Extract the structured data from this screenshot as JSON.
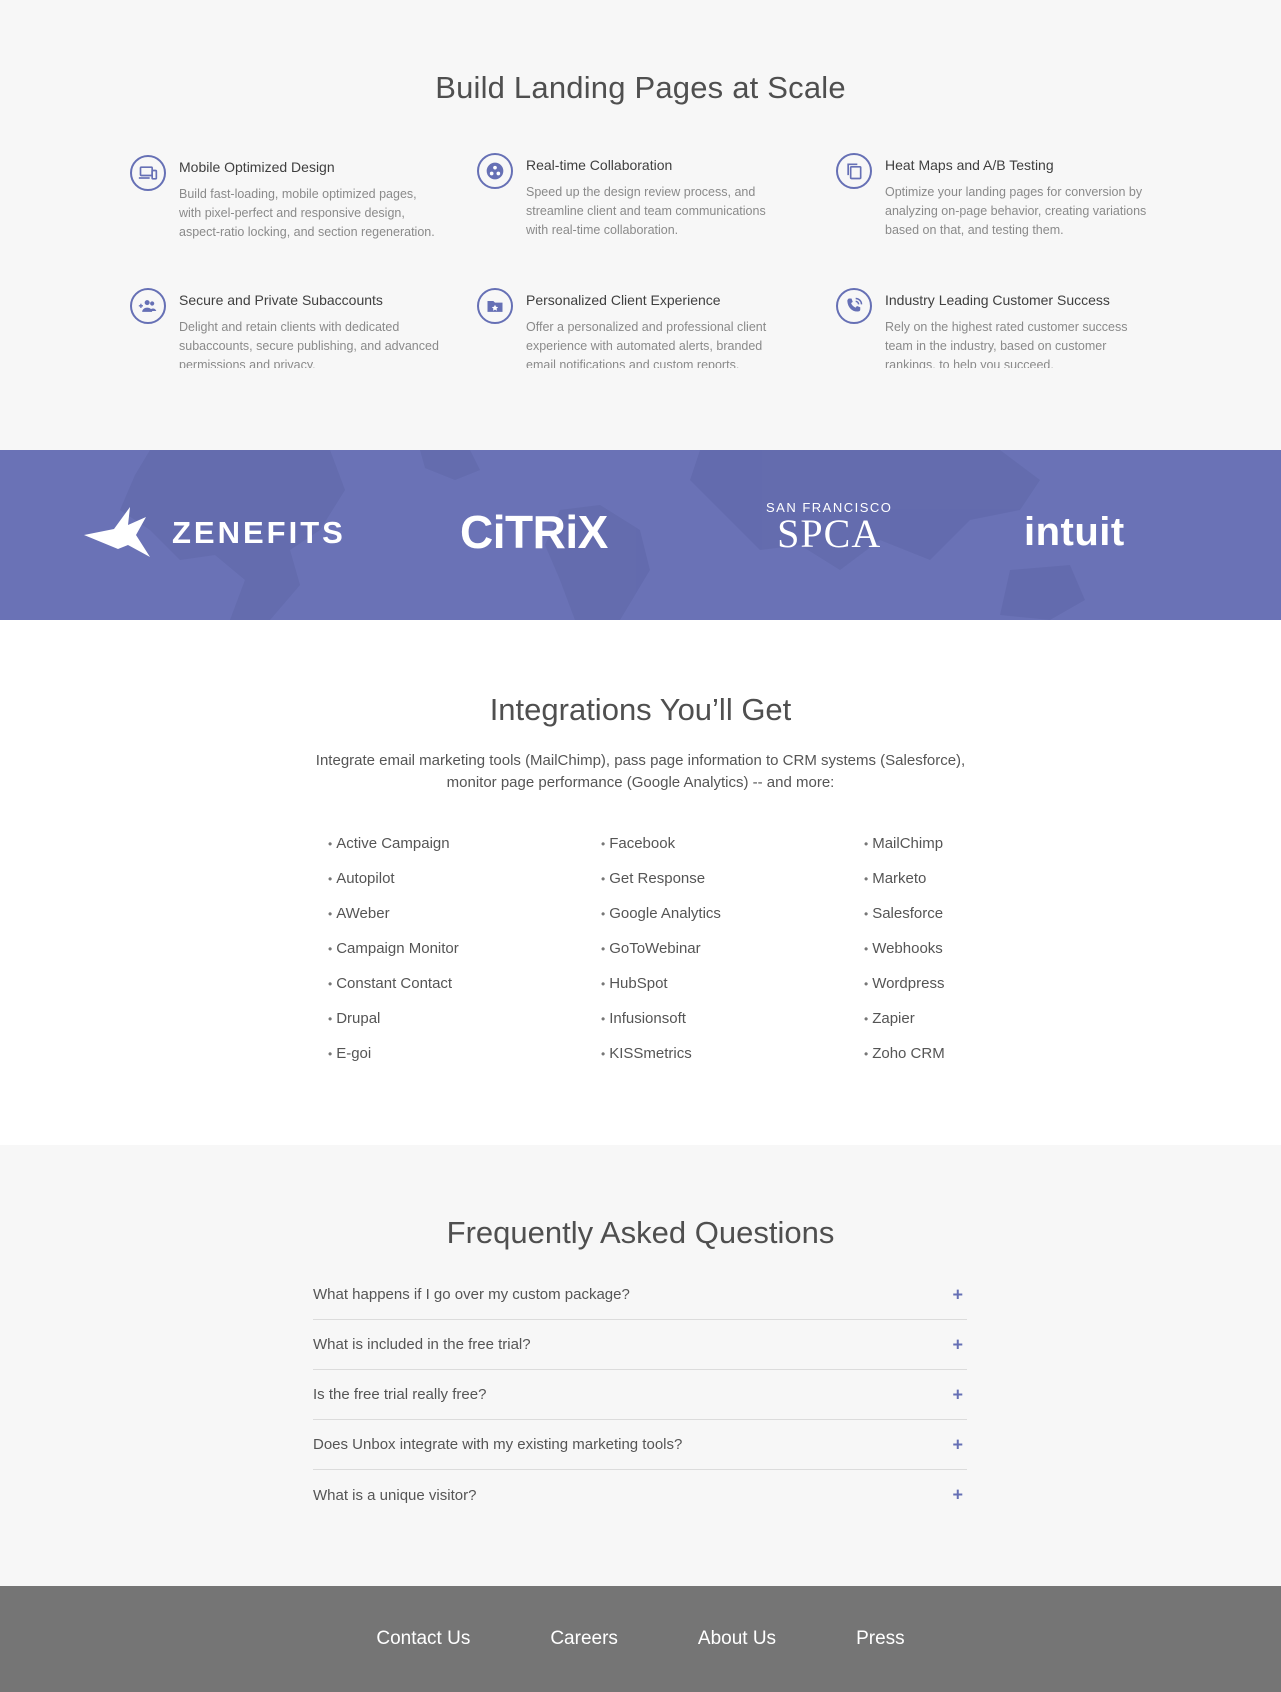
{
  "features": {
    "title": "Build Landing Pages at Scale",
    "items": [
      {
        "icon": "devices-icon",
        "title": "Mobile Optimized Design",
        "description": "Build fast-loading, mobile optimized pages, with pixel-perfect and responsive design, aspect-ratio locking, and section regeneration."
      },
      {
        "icon": "collaboration-icon",
        "title": "Real-time Collaboration",
        "description": "Speed up the design review process, and streamline client and team communications with real-time collaboration."
      },
      {
        "icon": "copy-icon",
        "title": "Heat Maps and A/B Testing",
        "description": "Optimize your landing pages for conversion by analyzing on-page behavior, creating variations based on that, and testing them."
      },
      {
        "icon": "group-add-icon",
        "title": "Secure and Private Subaccounts",
        "description": "Delight and retain clients with dedicated subaccounts, secure publishing, and advanced permissions and privacy."
      },
      {
        "icon": "folder-star-icon",
        "title": "Personalized Client Experience",
        "description": "Offer a personalized and professional client experience with automated alerts, branded email notifications and custom reports."
      },
      {
        "icon": "phone-icon",
        "title": "Industry Leading Customer Success",
        "description": "Rely on the highest rated customer success team in the industry, based on customer rankings, to help you succeed."
      }
    ]
  },
  "logos": {
    "zenefits": "ZENEFITS",
    "citrix": "CiTRiX",
    "spca_top": "SAN FRANCISCO",
    "spca_main": "SPCA",
    "intuit": "intuit"
  },
  "integrations": {
    "title": "Integrations You’ll Get",
    "intro": "Integrate email marketing tools (MailChimp), pass page information to CRM systems (Salesforce), monitor page performance (Google Analytics) -- and more:",
    "col1": [
      "Active Campaign",
      "Autopilot",
      "AWeber",
      "Campaign Monitor",
      "Constant Contact",
      "Drupal",
      "E-goi"
    ],
    "col2": [
      "Facebook",
      "Get Response",
      "Google Analytics",
      "GoToWebinar",
      "HubSpot",
      "Infusionsoft",
      "KISSmetrics"
    ],
    "col3": [
      "MailChimp",
      "Marketo",
      "Salesforce",
      "Webhooks",
      "Wordpress",
      "Zapier",
      "Zoho CRM"
    ]
  },
  "faq": {
    "title": "Frequently Asked Questions",
    "items": [
      "What happens if I go over my custom package?",
      "What is included in the free trial?",
      "Is the free trial really free?",
      "Does Unbox integrate with my existing marketing tools?",
      "What is a unique visitor?"
    ],
    "expand_symbol": "+"
  },
  "footer": {
    "links": [
      "Contact Us",
      "Careers",
      "About Us",
      "Press"
    ]
  },
  "colors": {
    "accent": "#6670b5",
    "band": "#6a72b6",
    "footer": "#757575",
    "section_bg": "#f7f7f7"
  }
}
